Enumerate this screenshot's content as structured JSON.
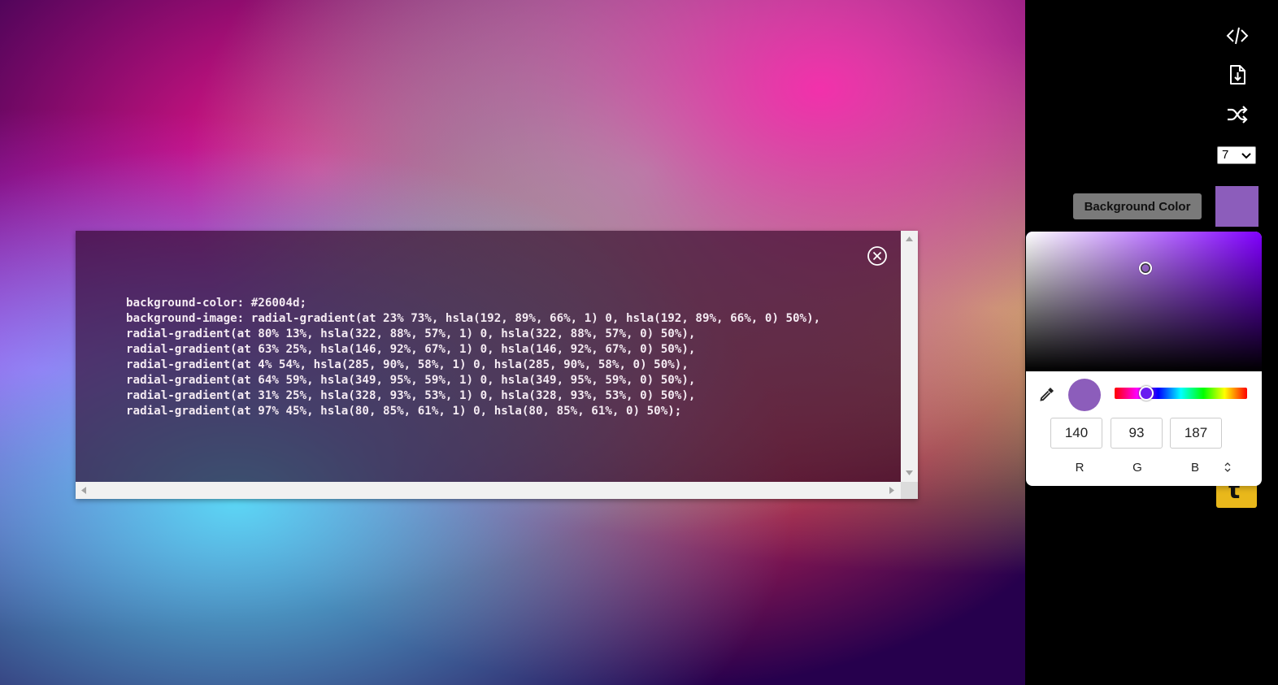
{
  "canvas": {
    "background_color": "#26004d"
  },
  "code_modal": {
    "lines": [
      "background-color: #26004d;",
      "background-image: radial-gradient(at 23% 73%, hsla(192, 89%, 66%, 1) 0, hsla(192, 89%, 66%, 0) 50%),",
      "radial-gradient(at 80% 13%, hsla(322, 88%, 57%, 1) 0, hsla(322, 88%, 57%, 0) 50%),",
      "radial-gradient(at 63% 25%, hsla(146, 92%, 67%, 1) 0, hsla(146, 92%, 67%, 0) 50%),",
      "radial-gradient(at 4% 54%, hsla(285, 90%, 58%, 1) 0, hsla(285, 90%, 58%, 0) 50%),",
      "radial-gradient(at 64% 59%, hsla(349, 95%, 59%, 1) 0, hsla(349, 95%, 59%, 0) 50%),",
      "radial-gradient(at 31% 25%, hsla(328, 93%, 53%, 1) 0, hsla(328, 93%, 53%, 0) 50%),",
      "radial-gradient(at 97% 45%, hsla(80, 85%, 61%, 1) 0, hsla(80, 85%, 61%, 0) 50%);"
    ],
    "close_icon": "close-circle-icon"
  },
  "toolbar": {
    "icons": [
      "code-icon",
      "download-file-icon",
      "shuffle-icon"
    ],
    "count_select": {
      "value": "7"
    },
    "background_color_label": "Background Color",
    "background_color": "#8c5dbb",
    "badge_letter": "t"
  },
  "color_picker": {
    "hue_color": "#8000ff",
    "current_color": "#8c5dbb",
    "r": "140",
    "g": "93",
    "b": "187",
    "labels": {
      "r": "R",
      "g": "G",
      "b": "B"
    }
  }
}
